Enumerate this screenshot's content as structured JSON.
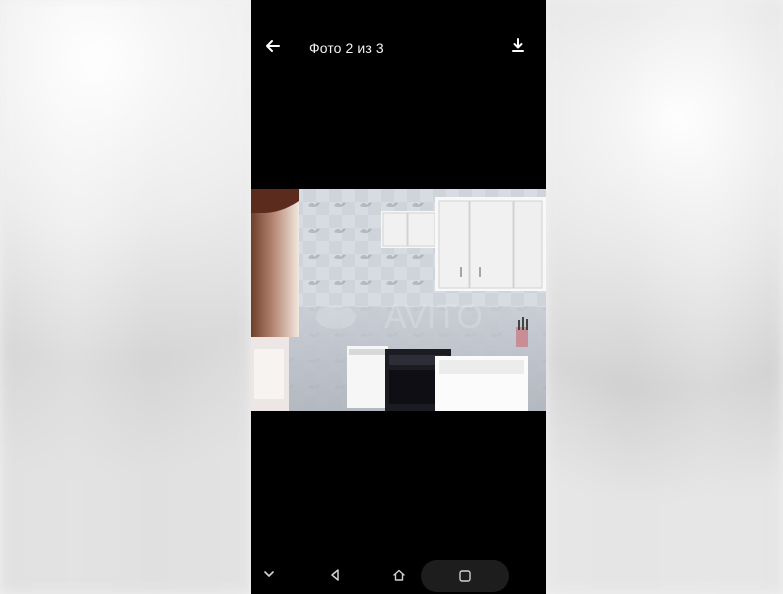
{
  "header": {
    "title": "Фото 2 из 3",
    "back_icon": "arrow-left-icon",
    "download_icon": "download-icon"
  },
  "photo": {
    "watermark": "AVITO"
  },
  "navigation": {
    "items": [
      {
        "icon": "chevron-down-icon"
      },
      {
        "icon": "triangle-back-icon"
      },
      {
        "icon": "home-icon"
      },
      {
        "icon": "recent-apps-icon"
      }
    ]
  },
  "colors": {
    "phone_background": "#000000",
    "page_background": "#f0f0f0",
    "foreground": "#ffffff"
  }
}
